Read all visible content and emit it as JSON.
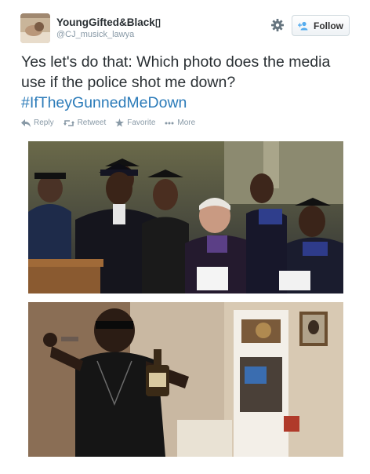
{
  "author": {
    "display_name": "YoungGifted&Black▯",
    "handle": "@CJ_musick_lawya"
  },
  "header": {
    "follow_label": "Follow"
  },
  "tweet": {
    "text": "Yes let's do that: Which photo does the media use if the police shot me down?",
    "hashtag": "#IfTheyGunnedMeDown"
  },
  "actions": {
    "reply": "Reply",
    "retweet": "Retweet",
    "favorite": "Favorite",
    "more": "More"
  },
  "photos": [
    {
      "description_icon": "graduation-photo"
    },
    {
      "description_icon": "party-photo"
    }
  ],
  "colors": {
    "hashtag": "#2b7bb9",
    "meta": "#8899a6",
    "text": "#292f33"
  }
}
